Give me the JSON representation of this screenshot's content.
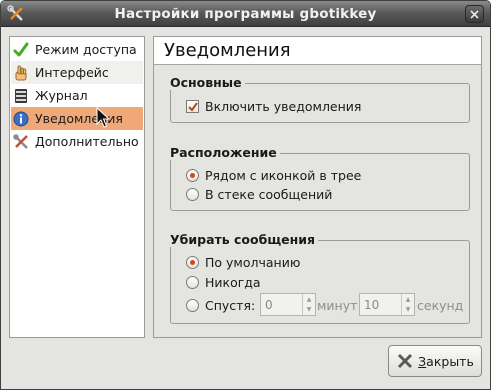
{
  "window": {
    "title": "Настройки программы gbotikkey"
  },
  "sidebar": {
    "items": [
      {
        "label": "Режим доступа",
        "icon": "checkmark-icon",
        "state": "normal"
      },
      {
        "label": "Интерфейс",
        "icon": "hand-icon",
        "state": "alt"
      },
      {
        "label": "Журнал",
        "icon": "journal-icon",
        "state": "normal"
      },
      {
        "label": "Уведомления",
        "icon": "info-icon",
        "state": "active"
      },
      {
        "label": "Дополнительно",
        "icon": "tools-icon",
        "state": "normal"
      }
    ]
  },
  "panel": {
    "title": "Уведомления",
    "groups": {
      "basic": {
        "title": "Основные",
        "enable_label": "Включить уведомления",
        "enable_checked": true
      },
      "location": {
        "title": "Расположение",
        "options": [
          "Рядом с иконкой в трее",
          "В стеке сообщений"
        ],
        "selected": 0
      },
      "dismiss": {
        "title": "Убирать сообщения",
        "options": [
          "По умолчанию",
          "Никогда",
          "Спустя:"
        ],
        "selected": 0,
        "minutes_value": "0",
        "minutes_unit": "минут",
        "seconds_value": "10",
        "seconds_unit": "секунд"
      }
    }
  },
  "footer": {
    "close_label_u": "З",
    "close_label_rest": "акрыть"
  },
  "colors": {
    "active_item": "#f0a878",
    "radio_dot": "#d14a10",
    "titlebar": "#4a4a4a"
  }
}
